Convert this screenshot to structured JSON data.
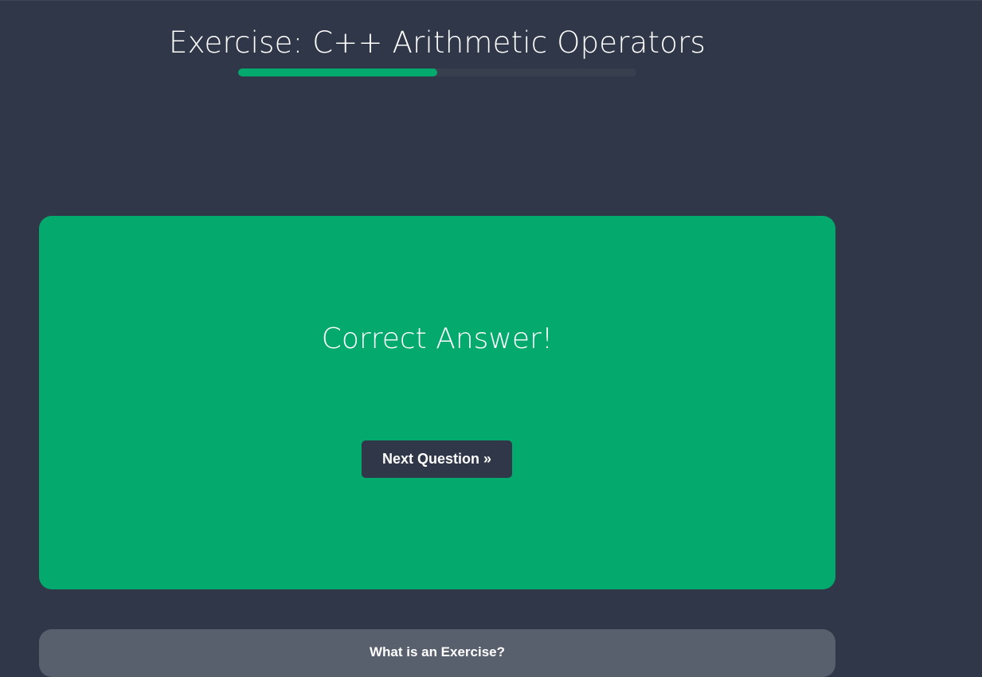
{
  "header": {
    "title": "Exercise: C++ Arithmetic Operators",
    "progress_percent": 50
  },
  "result": {
    "message": "Correct Answer!",
    "next_button_label": "Next Question »"
  },
  "info": {
    "title": "What is an Exercise?"
  },
  "colors": {
    "background": "#2f3748",
    "accent": "#04aa6d",
    "progress_track": "#38404f",
    "info_card": "#585f6d"
  }
}
